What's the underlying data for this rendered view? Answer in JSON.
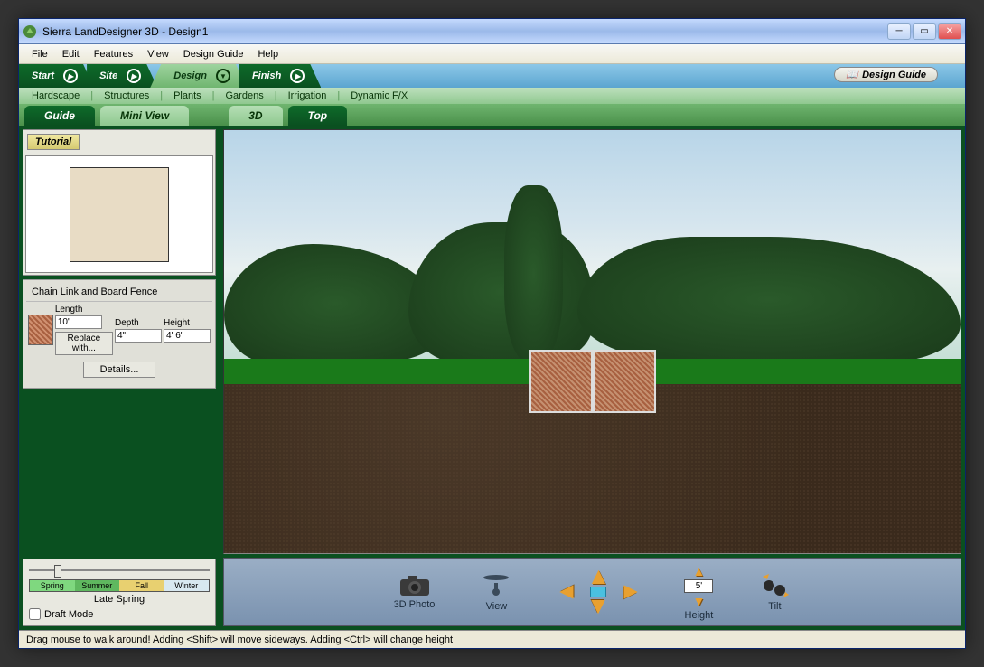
{
  "window": {
    "title": "Sierra LandDesigner 3D - Design1"
  },
  "menubar": [
    "File",
    "Edit",
    "Features",
    "View",
    "Design Guide",
    "Help"
  ],
  "workflow": {
    "tabs": [
      "Start",
      "Site",
      "Design",
      "Finish"
    ],
    "active": "Design",
    "guide_button": "Design Guide"
  },
  "categories": [
    "Hardscape",
    "Structures",
    "Plants",
    "Gardens",
    "Irrigation",
    "Dynamic F/X"
  ],
  "view_tabs": {
    "left": [
      "Guide",
      "Mini View"
    ],
    "right": [
      "3D",
      "Top"
    ],
    "active_left": "Mini View",
    "active_right": "3D"
  },
  "sidebar": {
    "tutorial_label": "Tutorial",
    "object_name": "Chain Link and Board Fence",
    "props": {
      "length_label": "Length",
      "length_value": "10'",
      "depth_label": "Depth",
      "depth_value": "4\"",
      "height_label": "Height",
      "height_value": "4' 6\""
    },
    "replace_label": "Replace with...",
    "details_label": "Details...",
    "seasons": [
      "Spring",
      "Summer",
      "Fall",
      "Winter"
    ],
    "season_current": "Late Spring",
    "draft_label": "Draft Mode",
    "draft_checked": false
  },
  "controls": {
    "photo_label": "3D Photo",
    "view_label": "View",
    "height_label": "Height",
    "height_value": "5'",
    "tilt_label": "Tilt"
  },
  "statusbar": "Drag mouse to walk around!  Adding <Shift> will move sideways. Adding <Ctrl> will change height"
}
